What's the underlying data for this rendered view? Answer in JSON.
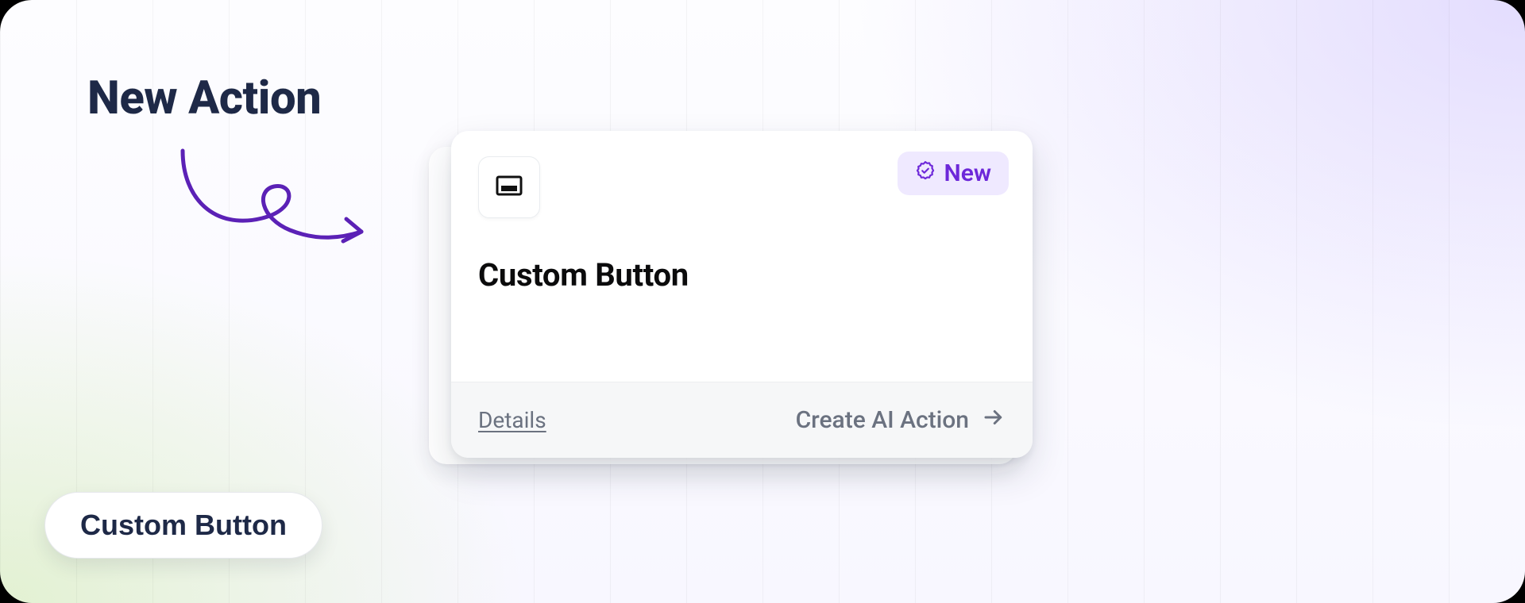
{
  "heading": "New Action",
  "card": {
    "icon_name": "button-icon",
    "badge": {
      "icon_name": "verified-icon",
      "label": "New"
    },
    "title": "Custom Button",
    "footer": {
      "details_label": "Details",
      "create_label": "Create AI Action"
    }
  },
  "pill_button_label": "Custom Button",
  "colors": {
    "accent_purple": "#6d28d9",
    "heading_navy": "#1e2947",
    "muted_gray": "#6b7280"
  }
}
